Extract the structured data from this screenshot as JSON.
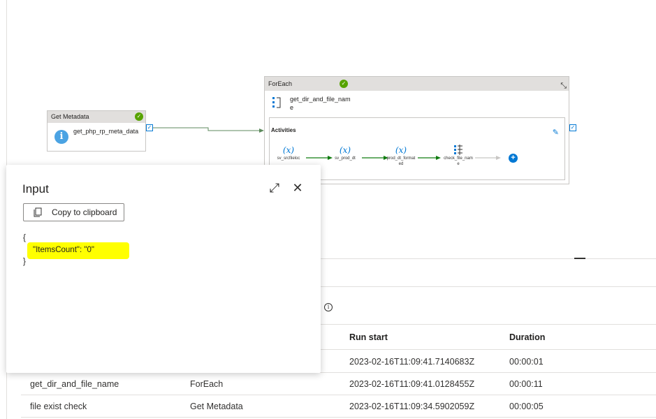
{
  "pipeline": {
    "get_metadata": {
      "type_label": "Get Metadata",
      "name": "get_php_rp_meta_data"
    },
    "foreach": {
      "type_label": "ForEach",
      "name": "get_dir_and_file_name",
      "activities_label": "Activities",
      "activities": [
        {
          "glyph": "(x)",
          "label": "sv_srcfileloc"
        },
        {
          "glyph": "(x)",
          "label": "sv_prod_dt"
        },
        {
          "glyph": "(x)",
          "label": "prod_dt_formated"
        },
        {
          "glyph": "",
          "label": "check_file_name"
        }
      ]
    }
  },
  "input_panel": {
    "title": "Input",
    "copy_label": "Copy to clipboard",
    "json_open": "{",
    "json_entry": "\"ItemsCount\": \"0\"",
    "json_close": "}"
  },
  "table": {
    "headers": [
      "Run start",
      "Duration"
    ],
    "rows": [
      {
        "name": "",
        "type": "",
        "run_start": "2023-02-16T11:09:41.7140683Z",
        "duration": "00:00:01"
      },
      {
        "name": "get_dir_and_file_name",
        "type": "ForEach",
        "run_start": "2023-02-16T11:09:41.0128455Z",
        "duration": "00:00:11"
      },
      {
        "name": "file exist check",
        "type": "Get Metadata",
        "run_start": "2023-02-16T11:09:34.5902059Z",
        "duration": "00:00:05"
      }
    ]
  },
  "colors": {
    "accent": "#0078d4",
    "success": "#57a300",
    "highlight": "#ffff00",
    "arrow_green": "#107c10"
  }
}
